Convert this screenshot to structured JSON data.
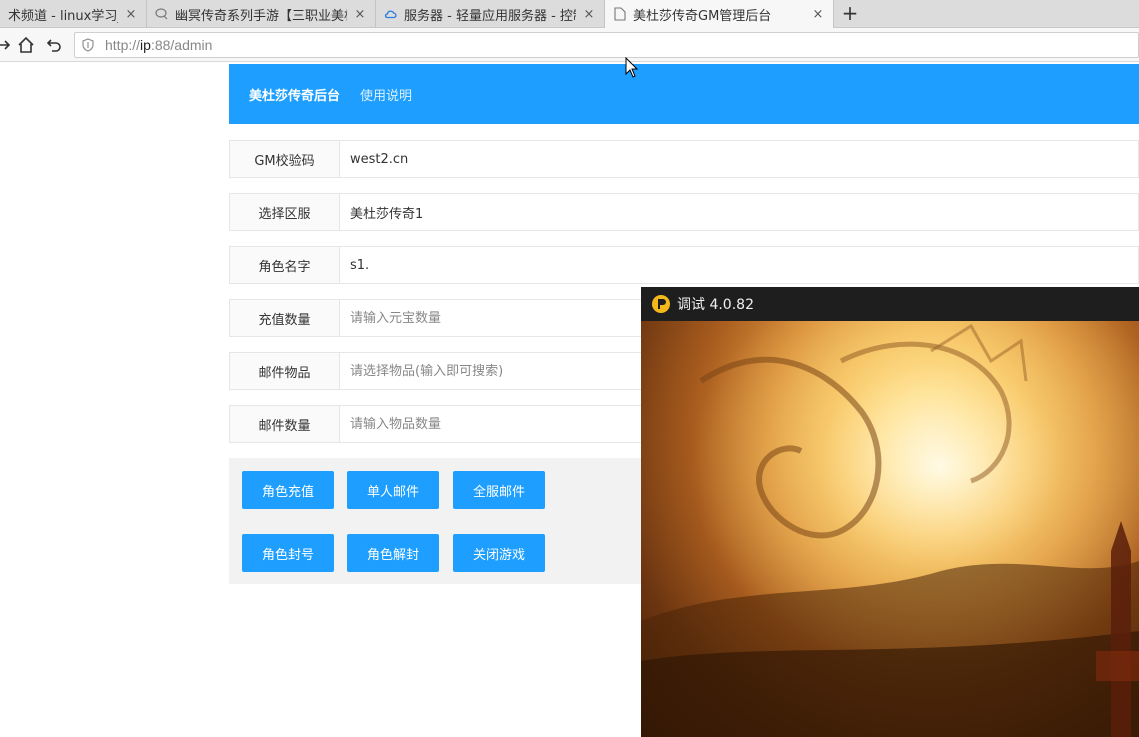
{
  "browser": {
    "tabs": [
      {
        "label": "术频道 - linux学习_网络",
        "icon": "page-icon"
      },
      {
        "label": "幽冥传奇系列手游【三职业美杜",
        "icon": "speech-bubble-icon"
      },
      {
        "label": "服务器 - 轻量应用服务器 - 控制",
        "icon": "cloud-icon"
      },
      {
        "label": "美杜莎传奇GM管理后台",
        "icon": "page-icon"
      }
    ],
    "close_glyph": "×",
    "new_tab_glyph": "+",
    "url_prefix": "http://",
    "url_host": "ip",
    "url_rest": ":88/admin"
  },
  "header": {
    "brand": "美杜莎传奇后台",
    "nav_link": "使用说明"
  },
  "form": {
    "fields": [
      {
        "label": "GM校验码",
        "value": "west2.cn",
        "placeholder": ""
      },
      {
        "label": "选择区服",
        "value": "美杜莎传奇1",
        "placeholder": ""
      },
      {
        "label": "角色名字",
        "value": "s1.",
        "placeholder": ""
      },
      {
        "label": "充值数量",
        "value": "",
        "placeholder": "请输入元宝数量"
      },
      {
        "label": "邮件物品",
        "value": "",
        "placeholder": "请选择物品(输入即可搜索)"
      },
      {
        "label": "邮件数量",
        "value": "",
        "placeholder": "请输入物品数量"
      }
    ]
  },
  "buttons": {
    "recharge": "角色充值",
    "single_mail": "单人邮件",
    "all_mail": "全服邮件",
    "ban": "角色封号",
    "unban": "角色解封",
    "close_game": "关闭游戏"
  },
  "debug_window": {
    "title": "调试 4.0.82"
  },
  "colors": {
    "accent": "#1e9fff",
    "header_text": "#ffffff"
  }
}
